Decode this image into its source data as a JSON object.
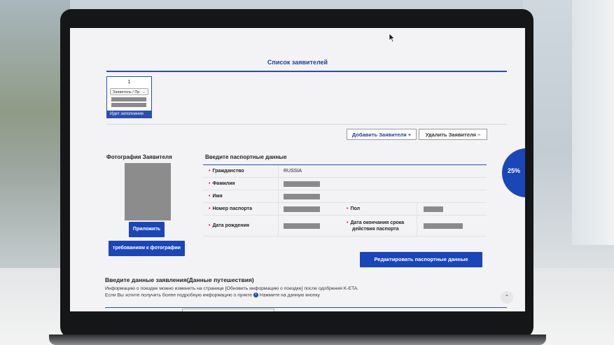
{
  "page": {
    "title": "Список заявителей"
  },
  "applicant_card": {
    "number": "1",
    "select_value": "Заявитель / Пр",
    "status": "Идет заполнение"
  },
  "actions": {
    "add_label": "Добавить Заявителя +",
    "remove_label": "Удалить Заявителя –"
  },
  "photo": {
    "section_title": "Фотография Заявителя",
    "attach_label": "Приложить",
    "requirements_label": "требованиям к фотографии"
  },
  "passport": {
    "section_title": "Введите паспортные данные",
    "citizenship_label": "Гражданство",
    "citizenship_value": "RUSSIA",
    "surname_label": "Фамилия",
    "name_label": "Имя",
    "passport_number_label": "Номер паспорта",
    "sex_label": "Пол",
    "birth_date_label": "Дата рождения",
    "expiry_label_1": "Дата окончания срока",
    "expiry_label_2": "действия паспорта",
    "edit_label": "Редактировать паспортные данные"
  },
  "trip": {
    "section_title": "Введите данные заявления(Данные путешествия)",
    "note_1": "Информацию о поездке можно изменить на странице [Обновить информацию о поездке] после одобрения K-ETA.",
    "note_2_before": "Если Вы хотите получить более подробную информацию о пункте",
    "note_2_after": "Нажмите на данную кнопку",
    "info_icon_glyph": "i"
  },
  "progress": {
    "value": "25%"
  },
  "scroll_top_glyph": "⌃"
}
